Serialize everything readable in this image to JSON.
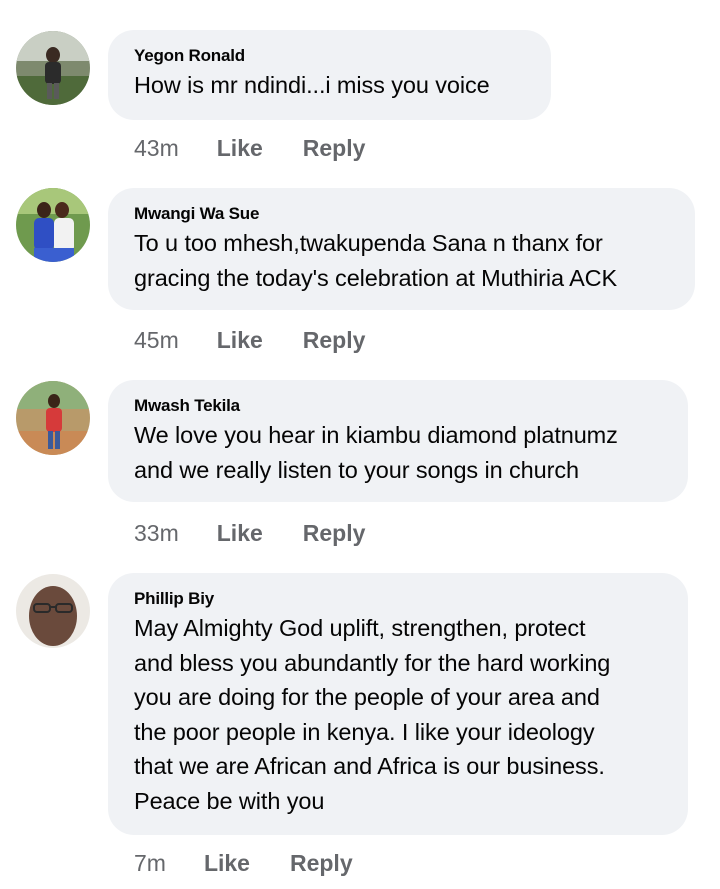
{
  "comments": [
    {
      "author": "Yegon Ronald",
      "text": "How is mr ndindi...i miss you voice",
      "time": "43m",
      "like_label": "Like",
      "reply_label": "Reply"
    },
    {
      "author": "Mwangi Wa Sue",
      "text_lines": [
        "To u too mhesh,twakupenda Sana n thanx for",
        "gracing the today's celebration at Muthiria ACK"
      ],
      "time": "45m",
      "like_label": "Like",
      "reply_label": "Reply"
    },
    {
      "author": "Mwash Tekila",
      "text_lines": [
        "We love you hear in kiambu diamond platnumz",
        "and we really listen to your songs in church"
      ],
      "time": "33m",
      "like_label": "Like",
      "reply_label": "Reply"
    },
    {
      "author": "Phillip Biy",
      "text_lines": [
        "May Almighty God uplift, strengthen, protect",
        "and bless you abundantly for the hard working",
        "you are doing for the people of your area and",
        "the poor people in kenya. I like your ideology",
        "that we are African and Africa is our business.",
        "Peace be with you"
      ],
      "time": "7m",
      "like_label": "Like",
      "reply_label": "Reply"
    }
  ],
  "colors": {
    "bubble_bg": "#f0f2f5",
    "meta_text": "#65676b",
    "primary_text": "#050505"
  }
}
